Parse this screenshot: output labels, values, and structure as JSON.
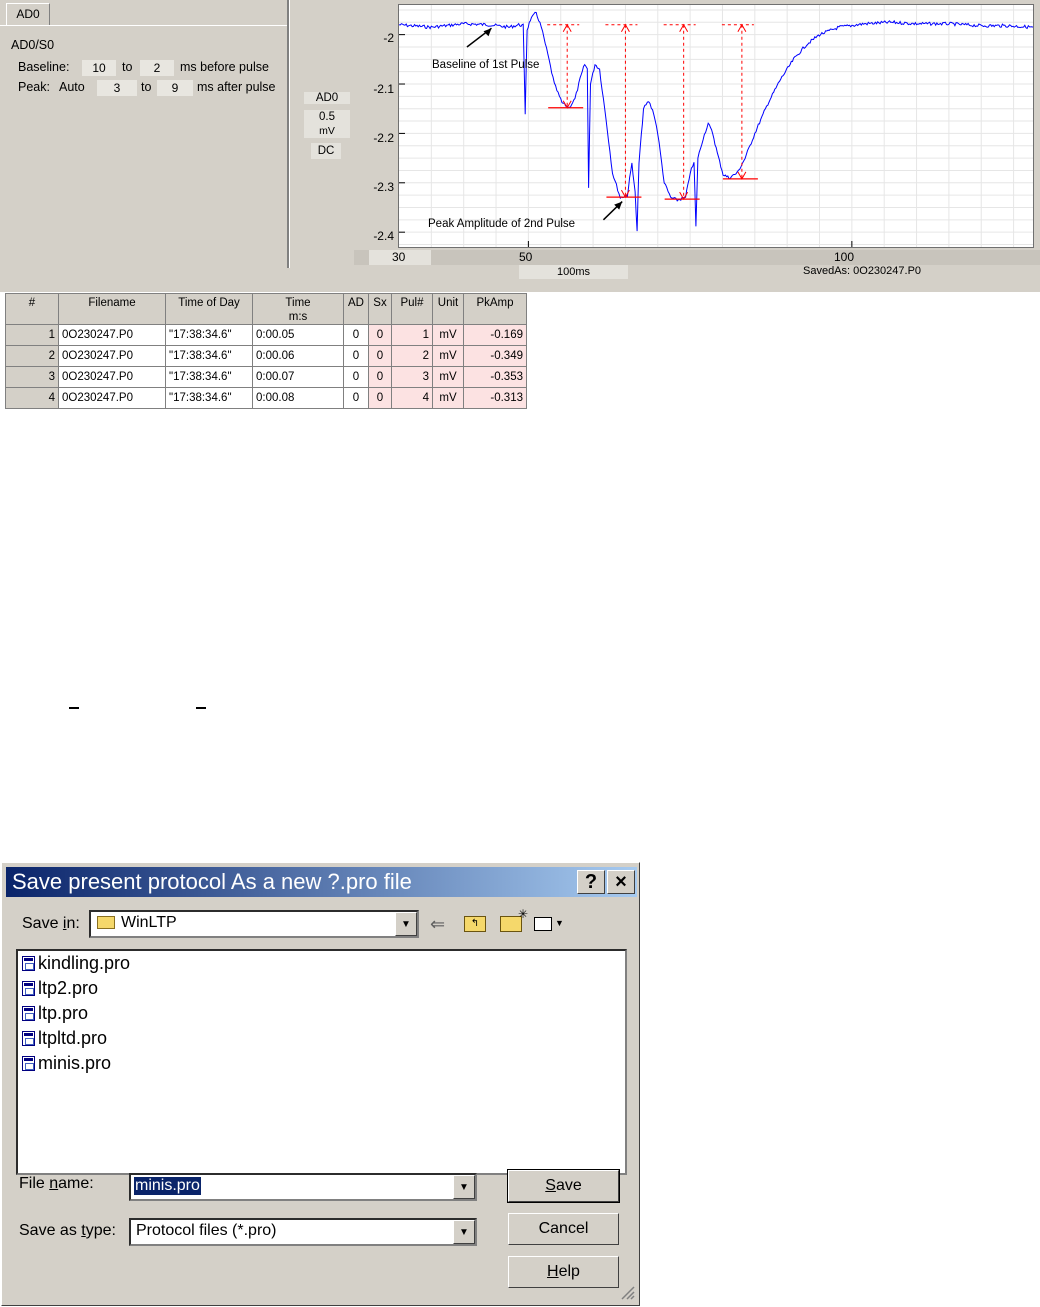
{
  "panel": {
    "tab": "AD0",
    "channel_path": "AD0/S0",
    "baseline": {
      "label": "Baseline:",
      "from": "10",
      "to_word": "to",
      "to": "2",
      "suffix": "ms before pulse"
    },
    "peak": {
      "label": "Peak:",
      "mode": "Auto",
      "from": "3",
      "to_word": "to",
      "to": "9",
      "suffix": "ms after pulse"
    },
    "channel_box": {
      "name": "AD0",
      "scale": "0.5",
      "unit": "mV",
      "coupling": "DC"
    },
    "strip": {
      "left_value": "30",
      "timebase": "100ms",
      "saved_as": "SavedAs: 0O230247.P0"
    }
  },
  "chart_data": {
    "type": "line",
    "x_ticks": [
      50,
      100
    ],
    "x_extra_label": "30",
    "y_ticks": [
      -2,
      -2.1,
      -2.2,
      -2.3,
      -2.4
    ],
    "xlim": [
      30,
      128
    ],
    "ylim": [
      -2.43,
      -1.94
    ],
    "grid": true,
    "annotations": [
      "Baseline of 1st Pulse",
      "Peak Amplitude of 2nd Pulse"
    ],
    "baseline_level": -1.98,
    "peaks": [
      {
        "x": 56,
        "y": -2.148
      },
      {
        "x": 65,
        "y": -2.329
      },
      {
        "x": 74,
        "y": -2.333
      },
      {
        "x": 83,
        "y": -2.292
      }
    ],
    "trace": [
      [
        30,
        -1.98
      ],
      [
        35,
        -1.985
      ],
      [
        40,
        -1.978
      ],
      [
        44,
        -1.98
      ],
      [
        47,
        -1.985
      ],
      [
        48.5,
        -1.98
      ],
      [
        49.2,
        -1.982
      ],
      [
        49.5,
        -2.16
      ],
      [
        49.8,
        -1.99
      ],
      [
        50.3,
        -1.97
      ],
      [
        51.2,
        -1.955
      ],
      [
        52,
        -1.985
      ],
      [
        53,
        -2.04
      ],
      [
        54,
        -2.1
      ],
      [
        55.2,
        -2.138
      ],
      [
        56.3,
        -2.148
      ],
      [
        57.2,
        -2.13
      ],
      [
        58,
        -2.09
      ],
      [
        58.7,
        -2.06
      ],
      [
        59.1,
        -2.07
      ],
      [
        59.3,
        -2.31
      ],
      [
        59.6,
        -2.1
      ],
      [
        60.3,
        -2.06
      ],
      [
        61,
        -2.07
      ],
      [
        62,
        -2.17
      ],
      [
        63,
        -2.28
      ],
      [
        64.2,
        -2.33
      ],
      [
        65.3,
        -2.325
      ],
      [
        66,
        -2.26
      ],
      [
        66.5,
        -2.32
      ],
      [
        66.8,
        -2.4
      ],
      [
        67.1,
        -2.26
      ],
      [
        67.8,
        -2.15
      ],
      [
        68.6,
        -2.135
      ],
      [
        69.4,
        -2.16
      ],
      [
        70,
        -2.2
      ],
      [
        71,
        -2.3
      ],
      [
        72,
        -2.33
      ],
      [
        73,
        -2.335
      ],
      [
        74.3,
        -2.33
      ],
      [
        75,
        -2.28
      ],
      [
        75.6,
        -2.26
      ],
      [
        75.9,
        -2.39
      ],
      [
        76.2,
        -2.25
      ],
      [
        77,
        -2.21
      ],
      [
        77.8,
        -2.18
      ],
      [
        78.5,
        -2.2
      ],
      [
        79.2,
        -2.24
      ],
      [
        80.1,
        -2.283
      ],
      [
        81,
        -2.29
      ],
      [
        82.3,
        -2.28
      ],
      [
        83.5,
        -2.25
      ],
      [
        85,
        -2.2
      ],
      [
        87,
        -2.14
      ],
      [
        89,
        -2.09
      ],
      [
        91,
        -2.05
      ],
      [
        93,
        -2.02
      ],
      [
        95,
        -2.0
      ],
      [
        98,
        -1.985
      ],
      [
        102,
        -1.978
      ],
      [
        106,
        -1.975
      ],
      [
        110,
        -1.978
      ],
      [
        115,
        -1.978
      ],
      [
        120,
        -1.982
      ],
      [
        124,
        -1.982
      ],
      [
        128,
        -1.985
      ]
    ]
  },
  "table": {
    "headers": [
      {
        "line1": "#",
        "line2": ""
      },
      {
        "line1": "Filename",
        "line2": ""
      },
      {
        "line1": "Time of Day",
        "line2": ""
      },
      {
        "line1": "Time",
        "line2": "m:s"
      },
      {
        "line1": "AD",
        "line2": ""
      },
      {
        "line1": "Sx",
        "line2": ""
      },
      {
        "line1": "Pul#",
        "line2": ""
      },
      {
        "line1": "Unit",
        "line2": ""
      },
      {
        "line1": "PkAmp",
        "line2": ""
      }
    ],
    "rows": [
      {
        "n": "1",
        "filename": "0O230247.P0",
        "tod": "\"17:38:34.6\"",
        "time": "0:00.05",
        "ad": "0",
        "sx": "0",
        "pul": "1",
        "unit": "mV",
        "pkamp": "-0.169"
      },
      {
        "n": "2",
        "filename": "0O230247.P0",
        "tod": "\"17:38:34.6\"",
        "time": "0:00.06",
        "ad": "0",
        "sx": "0",
        "pul": "2",
        "unit": "mV",
        "pkamp": "-0.349"
      },
      {
        "n": "3",
        "filename": "0O230247.P0",
        "tod": "\"17:38:34.6\"",
        "time": "0:00.07",
        "ad": "0",
        "sx": "0",
        "pul": "3",
        "unit": "mV",
        "pkamp": "-0.353"
      },
      {
        "n": "4",
        "filename": "0O230247.P0",
        "tod": "\"17:38:34.6\"",
        "time": "0:00.08",
        "ad": "0",
        "sx": "0",
        "pul": "4",
        "unit": "mV",
        "pkamp": "-0.313"
      }
    ]
  },
  "dialog": {
    "title": "Save present protocol As a new ?.pro file",
    "help_btn": "?",
    "close_btn": "×",
    "save_in_label_pre": "Save ",
    "save_in_label_key": "i",
    "save_in_label_post": "n:",
    "save_in_value": "WinLTP",
    "files": [
      "kindling.pro",
      "ltp2.pro",
      "ltp.pro",
      "ltpltd.pro",
      "minis.pro"
    ],
    "filename_label_pre": "File ",
    "filename_label_key": "n",
    "filename_label_post": "ame:",
    "filename_value": "minis.pro",
    "type_label_pre": "Save as ",
    "type_label_key": "t",
    "type_label_post": "ype:",
    "type_value": "Protocol files (*.pro)",
    "save_btn_key": "S",
    "save_btn_rest": "ave",
    "cancel_btn": "Cancel",
    "help_btn_key": "H",
    "help_btn_rest": "elp",
    "colors": {
      "title_start": "#0a246a",
      "title_end": "#a6caf0",
      "trace": "#0000ff",
      "marker": "#ff0000",
      "pink_cell": "#fce2e2"
    },
    "icons": [
      "folder-icon",
      "back-arrow-icon",
      "up-folder-icon",
      "new-folder-icon",
      "view-menu-icon",
      "file-icon",
      "resize-grip-icon"
    ]
  }
}
